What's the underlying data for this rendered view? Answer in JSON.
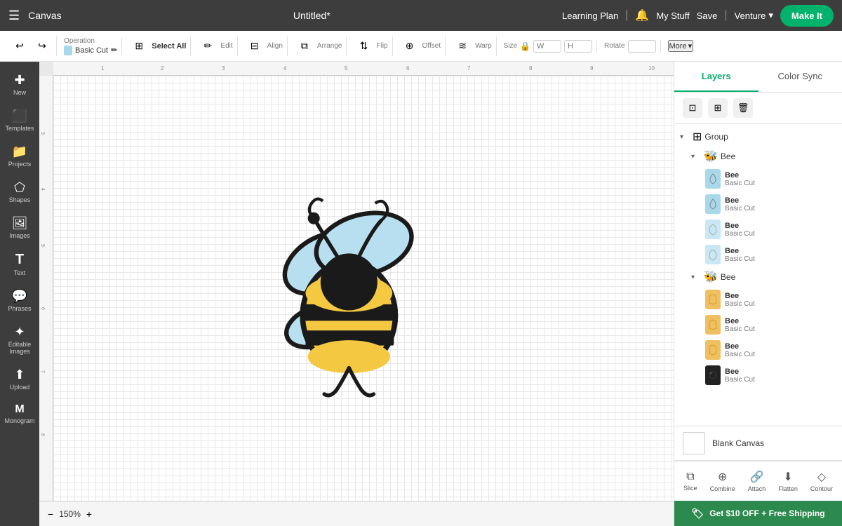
{
  "topNav": {
    "hamburger": "☰",
    "appTitle": "Canvas",
    "projectTitle": "Untitled*",
    "learningPlan": "Learning Plan",
    "separator1": "|",
    "bellIcon": "🔔",
    "myStuff": "My Stuff",
    "save": "Save",
    "separator2": "|",
    "venture": "Venture",
    "makeIt": "Make It"
  },
  "toolbar": {
    "undoIcon": "↩",
    "redoIcon": "↪",
    "operationLabel": "Operation",
    "operationValue": "Basic Cut",
    "selectAllLabel": "Select All",
    "editLabel": "Edit",
    "alignLabel": "Align",
    "arrangeLabel": "Arrange",
    "flipLabel": "Flip",
    "offsetLabel": "Offset",
    "warpLabel": "Warp",
    "sizeLabel": "Size",
    "lockIcon": "🔒",
    "rotateLabel": "Rotate",
    "moreLabel": "More",
    "moreIcon": "▾"
  },
  "sidebar": {
    "items": [
      {
        "icon": "✚",
        "label": "New"
      },
      {
        "icon": "⬛",
        "label": "Templates"
      },
      {
        "icon": "📁",
        "label": "Projects"
      },
      {
        "icon": "⬠",
        "label": "Shapes"
      },
      {
        "icon": "🖼",
        "label": "Images"
      },
      {
        "icon": "T",
        "label": "Text"
      },
      {
        "icon": "💬",
        "label": "Phrases"
      },
      {
        "icon": "✦",
        "label": "Editable Images"
      },
      {
        "icon": "⬆",
        "label": "Upload"
      },
      {
        "icon": "M",
        "label": "Monogram"
      }
    ]
  },
  "canvas": {
    "zoom": "150%",
    "zoomIn": "+",
    "zoomOut": "−"
  },
  "rightPanel": {
    "tabs": [
      {
        "label": "Layers",
        "active": true
      },
      {
        "label": "Color Sync",
        "active": false
      }
    ],
    "actionIcons": [
      "⊡",
      "⊞",
      "🗑"
    ],
    "layers": {
      "group": {
        "name": "Group",
        "expandIcon": "▾",
        "groupIcon": "⊞",
        "subgroups": [
          {
            "name": "Bee",
            "expandIcon": "▾",
            "groupIcon": "🐝",
            "items": [
              {
                "name": "Bee",
                "type": "Basic Cut",
                "color": "#a8d8ea",
                "swatchIcon": "💧"
              },
              {
                "name": "Bee",
                "type": "Basic Cut",
                "color": "#a8d8ea",
                "swatchIcon": "💧"
              },
              {
                "name": "Bee",
                "type": "Basic Cut",
                "color": "#c8e0f0",
                "swatchIcon": "💧"
              },
              {
                "name": "Bee",
                "type": "Basic Cut",
                "color": "#c8e0f0",
                "swatchIcon": "💧"
              }
            ]
          },
          {
            "name": "Bee",
            "expandIcon": "▾",
            "groupIcon": "🐝",
            "items": [
              {
                "name": "Bee",
                "type": "Basic Cut",
                "color": "#f0c060",
                "swatchIcon": "🍂"
              },
              {
                "name": "Bee",
                "type": "Basic Cut",
                "color": "#f0c060",
                "swatchIcon": "🍂"
              },
              {
                "name": "Bee",
                "type": "Basic Cut",
                "color": "#f0c060",
                "swatchIcon": "🍂"
              },
              {
                "name": "Bee",
                "type": "Basic Cut",
                "color": "#222222",
                "swatchIcon": "🐝"
              }
            ]
          }
        ]
      }
    },
    "blankCanvas": "Blank Canvas",
    "bottomActions": [
      {
        "icon": "⧉",
        "label": "Slice"
      },
      {
        "icon": "⊕",
        "label": "Combine"
      },
      {
        "icon": "🔗",
        "label": "Attach"
      },
      {
        "icon": "⬇",
        "label": "Flatten"
      },
      {
        "icon": "◇",
        "label": "Contour"
      }
    ]
  },
  "promoBar": {
    "icon": "🏷",
    "text": "Get $10 OFF + Free Shipping"
  }
}
